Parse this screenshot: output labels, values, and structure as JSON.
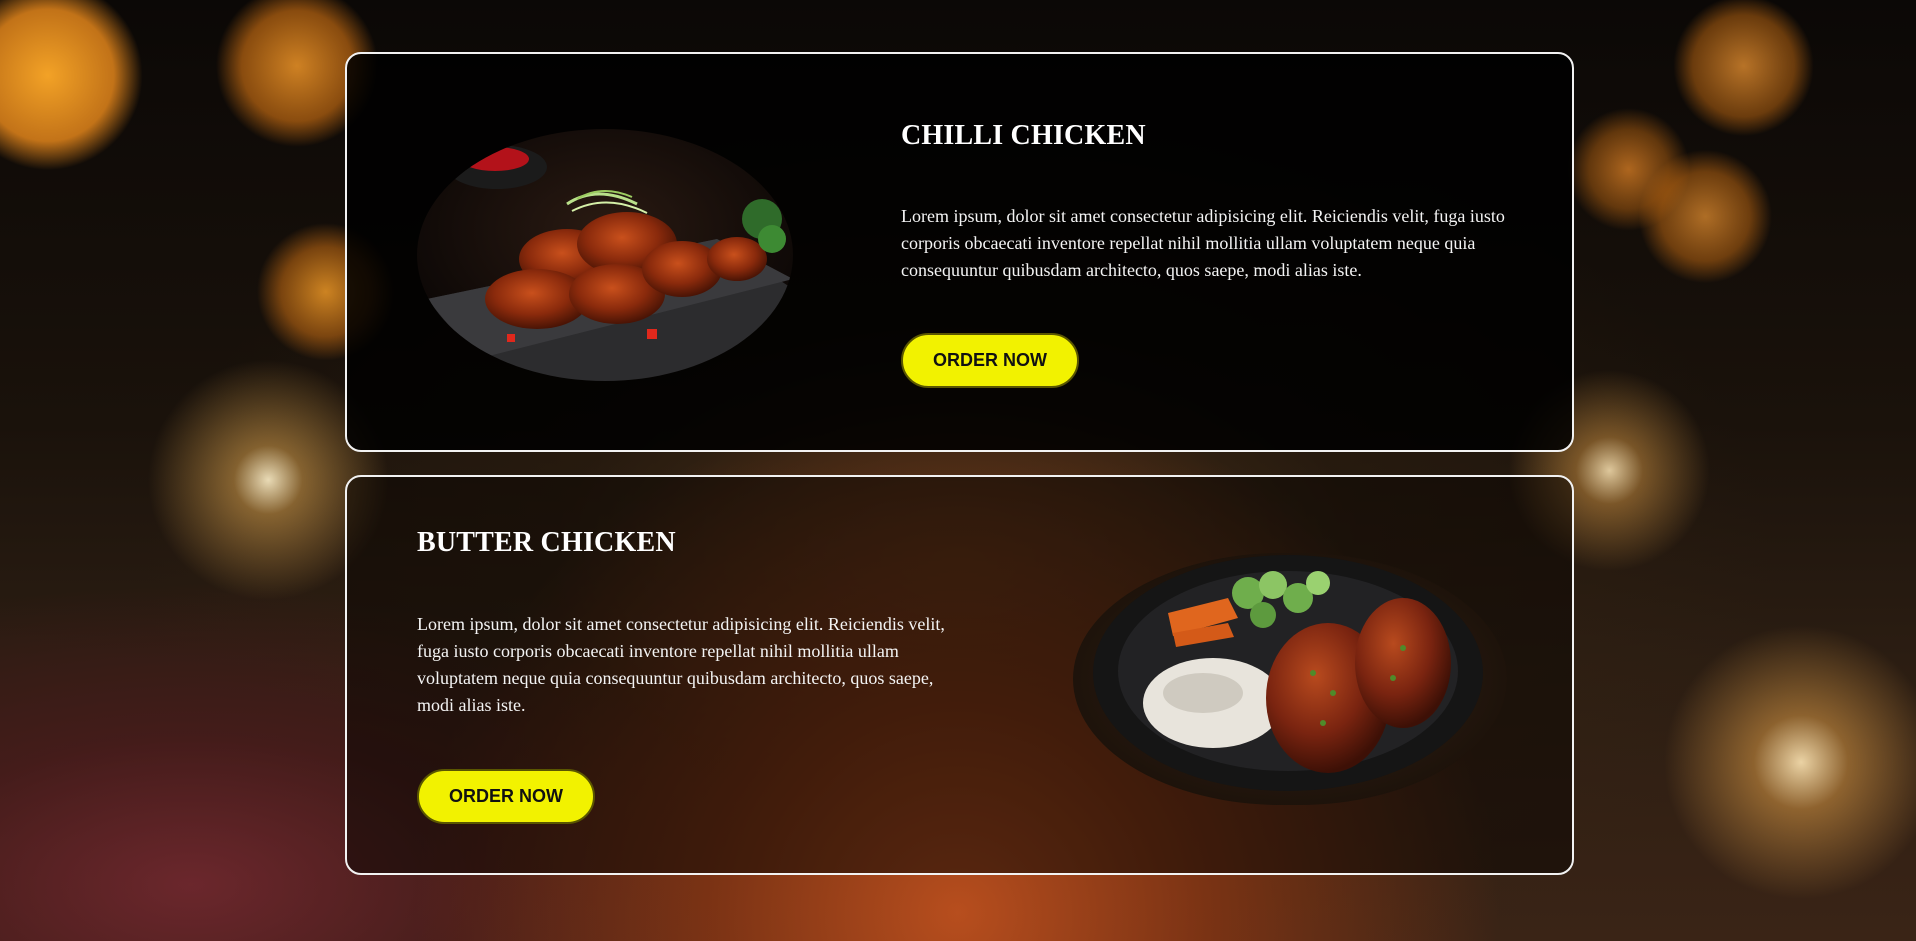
{
  "menu_items": [
    {
      "title": "CHILLI CHICKEN",
      "description": "Lorem ipsum, dolor sit amet consectetur adipisicing elit. Reiciendis velit, fuga iusto corporis obcaecati inventore repellat nihil mollitia ullam voluptatem neque quia consequuntur quibusdam architecto, quos saepe, modi alias iste.",
      "button_label": "ORDER NOW",
      "image_subject": "chilli-chicken-photo"
    },
    {
      "title": "BUTTER CHICKEN",
      "description": "Lorem ipsum, dolor sit amet consectetur adipisicing elit. Reiciendis velit, fuga iusto corporis obcaecati inventore repellat nihil mollitia ullam voluptatem neque quia consequuntur quibusdam architecto, quos saepe, modi alias iste.",
      "button_label": "ORDER NOW",
      "image_subject": "butter-chicken-photo"
    }
  ],
  "colors": {
    "button_bg": "#f2f200",
    "card_border": "#f2f2f2",
    "text": "#ffffff"
  }
}
